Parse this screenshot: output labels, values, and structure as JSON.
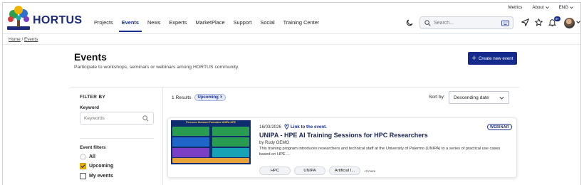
{
  "header": {
    "logo_text": "HORTUS",
    "nav": [
      "Projects",
      "Events",
      "News",
      "Experts",
      "MarketPlace",
      "Support",
      "Social",
      "Training Center"
    ],
    "active_nav": "Events",
    "util": {
      "metrics": "Metrics",
      "about": "About",
      "lang": "ENG"
    },
    "search_placeholder": "Search...",
    "notif_badge": "9+"
  },
  "breadcrumb": {
    "home": "Home",
    "sep": "/",
    "current": "Events"
  },
  "page": {
    "title": "Events",
    "subtitle": "Participate to workshops, seminars or webinars among HORTUS community.",
    "create_button": "Create new event"
  },
  "sidebar": {
    "filter_by": "FILTER BY",
    "keyword_label": "Keyword",
    "keyword_placeholder": "Keywords",
    "event_filters_label": "Event filters",
    "options": [
      {
        "label": "All",
        "kind": "radio",
        "checked": false
      },
      {
        "label": "Upcoming",
        "kind": "checkbox",
        "checked": true
      },
      {
        "label": "My events",
        "kind": "checkbox",
        "checked": false
      }
    ]
  },
  "results": {
    "count_text": "1 Results",
    "active_filter": "Upcoming",
    "sort_label": "Sort by:",
    "sort_value": "Descending date"
  },
  "events": [
    {
      "date": "16/03/2026",
      "link_text": "Link to the event.",
      "type": "WEBINAR",
      "title": "UNIPA - HPE AI Training Sessions for HPC Researchers",
      "by": "by Rudy OEMO",
      "description": "This training program introduces researchers and technical staff at the University of Palermo (UNIPA) to a series of practical use cases based on HPE ...",
      "tags": [
        "HPC",
        "UNIPA",
        "Artificial I..."
      ],
      "more": "+3 more",
      "thumb_title": "Percorso Sessioni Formative UNIPA HPE"
    }
  ],
  "colors": {
    "brand": "#1b2f8c",
    "accent_check": "#f0b400"
  }
}
